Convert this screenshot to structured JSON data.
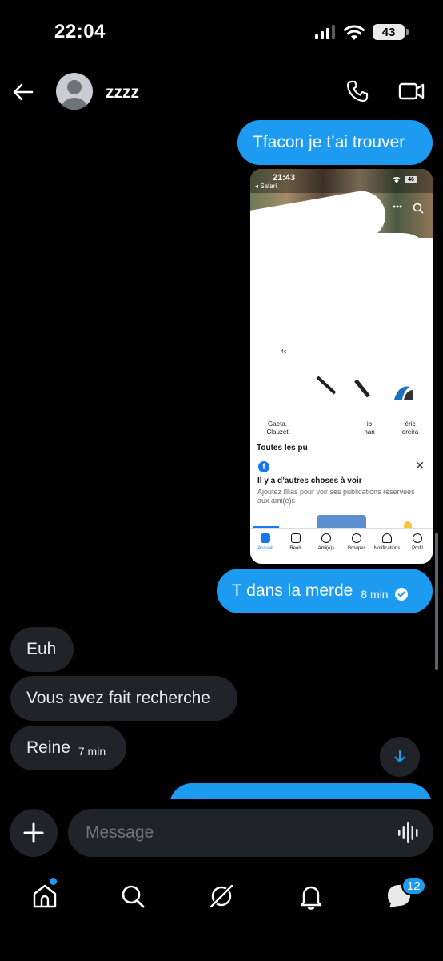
{
  "status_bar": {
    "time": "22:04",
    "battery": "43"
  },
  "header": {
    "contact_name": "zzzz"
  },
  "messages": [
    {
      "direction": "outgoing",
      "text": "Tfacon je t’ai trouver"
    },
    {
      "direction": "outgoing",
      "type": "image"
    },
    {
      "direction": "outgoing",
      "text": "T dans la merde",
      "time": "8 min"
    },
    {
      "direction": "incoming",
      "text": "Euh"
    },
    {
      "direction": "incoming",
      "text": "Vous avez fait recherche"
    },
    {
      "direction": "incoming",
      "text": "Reine",
      "time": "7 min"
    }
  ],
  "screenshot": {
    "time": "21:43",
    "browser": "◂ Safari",
    "battery": "46",
    "friends": [
      {
        "first": "Gaeta.",
        "last": "Clauzet"
      },
      {
        "first": "ib",
        "last": "nan"
      },
      {
        "first": "éric",
        "last": "ereira"
      }
    ],
    "section_title": "Toutes les pu",
    "notice_title": "Il y a d’autres choses à voir",
    "notice_body": "Ajoutez Illias pour voir ses publications réservées aux ami(e)s",
    "nav": [
      "Accueil",
      "Reels",
      "Ami(e)s",
      "Groupes",
      "Notifications",
      "Profil"
    ]
  },
  "composer": {
    "placeholder": "Message"
  },
  "bottom_nav": {
    "messages_badge": "12"
  },
  "colors": {
    "accent": "#1d9bf0",
    "incoming_bubble": "#202327",
    "background": "#000000"
  }
}
